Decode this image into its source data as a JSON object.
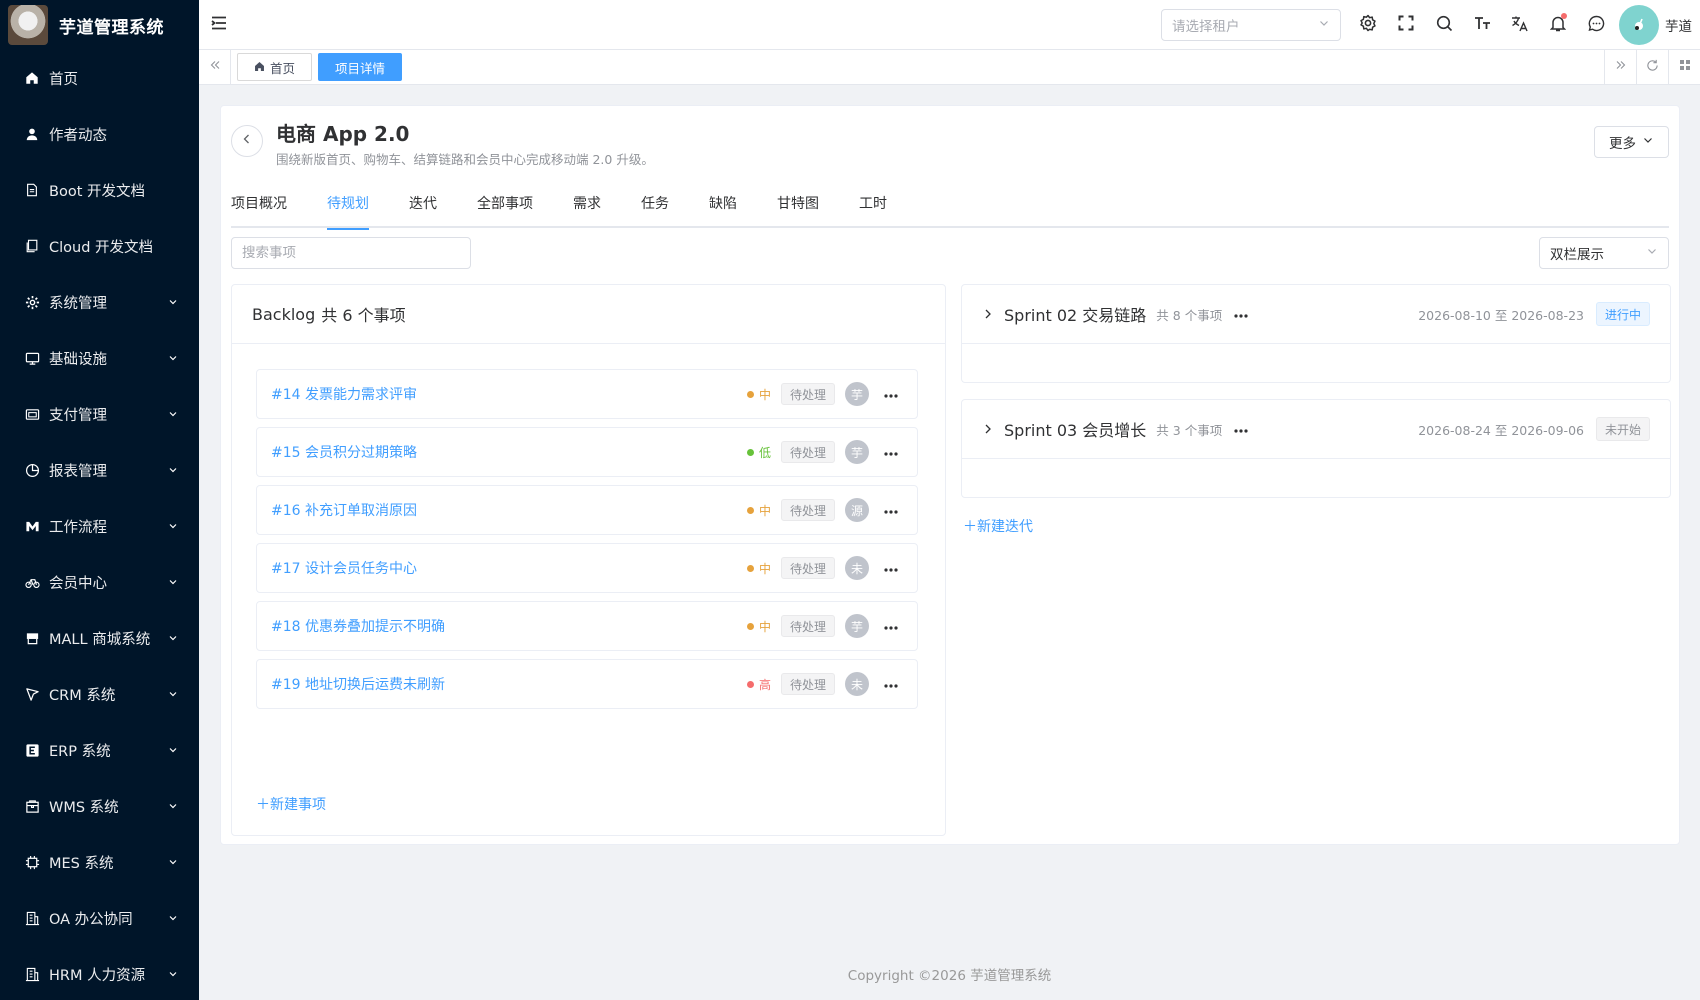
{
  "app": {
    "title": "芋道管理系统"
  },
  "sidebar": {
    "items": [
      {
        "label": "首页",
        "icon": "home-icon",
        "arrow": false
      },
      {
        "label": "作者动态",
        "icon": "user-icon",
        "arrow": false
      },
      {
        "label": "Boot 开发文档",
        "icon": "document-icon",
        "arrow": false
      },
      {
        "label": "Cloud 开发文档",
        "icon": "document-copy-icon",
        "arrow": false
      },
      {
        "label": "系统管理",
        "icon": "gear-icon",
        "arrow": true
      },
      {
        "label": "基础设施",
        "icon": "monitor-icon",
        "arrow": true
      },
      {
        "label": "支付管理",
        "icon": "wallet-icon",
        "arrow": true
      },
      {
        "label": "报表管理",
        "icon": "pie-chart-icon",
        "arrow": true
      },
      {
        "label": "工作流程",
        "icon": "workflow-icon",
        "arrow": true
      },
      {
        "label": "会员中心",
        "icon": "bicycle-icon",
        "arrow": true
      },
      {
        "label": "MALL 商城系统",
        "icon": "shop-icon",
        "arrow": true
      },
      {
        "label": "CRM 系统",
        "icon": "crm-icon",
        "arrow": true
      },
      {
        "label": "ERP 系统",
        "icon": "erp-icon",
        "arrow": true
      },
      {
        "label": "WMS 系统",
        "icon": "box-icon",
        "arrow": true
      },
      {
        "label": "MES 系统",
        "icon": "cpu-icon",
        "arrow": true
      },
      {
        "label": "OA 办公协同",
        "icon": "office-icon",
        "arrow": true
      },
      {
        "label": "HRM 人力资源",
        "icon": "office-icon",
        "arrow": true
      }
    ]
  },
  "header": {
    "tenant_placeholder": "请选择租户",
    "user_name": "芋道"
  },
  "tagsbar": {
    "tabs": [
      {
        "label": "首页",
        "active": false
      },
      {
        "label": "项目详情",
        "active": true
      }
    ]
  },
  "project": {
    "title": "电商 App 2.0",
    "description": "围绕新版首页、购物车、结算链路和会员中心完成移动端 2.0 升级。",
    "more_label": "更多"
  },
  "tabs": [
    {
      "label": "项目概况",
      "active": false
    },
    {
      "label": "待规划",
      "active": true
    },
    {
      "label": "迭代",
      "active": false
    },
    {
      "label": "全部事项",
      "active": false
    },
    {
      "label": "需求",
      "active": false
    },
    {
      "label": "任务",
      "active": false
    },
    {
      "label": "缺陷",
      "active": false
    },
    {
      "label": "甘特图",
      "active": false
    },
    {
      "label": "工时",
      "active": false
    }
  ],
  "toolbar": {
    "search_placeholder": "搜索事项",
    "view_mode": "双栏展示"
  },
  "backlog": {
    "title": "Backlog",
    "count_text": "共 6 个事项",
    "new_issue_label": "＋新建事项",
    "issues": [
      {
        "title": "#14 发票能力需求评审",
        "priority": "中",
        "priority_color": "#e6a23c",
        "status": "待处理",
        "assignee": "芋"
      },
      {
        "title": "#15 会员积分过期策略",
        "priority": "低",
        "priority_color": "#67c23a",
        "status": "待处理",
        "assignee": "芋"
      },
      {
        "title": "#16 补充订单取消原因",
        "priority": "中",
        "priority_color": "#e6a23c",
        "status": "待处理",
        "assignee": "源"
      },
      {
        "title": "#17 设计会员任务中心",
        "priority": "中",
        "priority_color": "#e6a23c",
        "status": "待处理",
        "assignee": "未"
      },
      {
        "title": "#18 优惠券叠加提示不明确",
        "priority": "中",
        "priority_color": "#e6a23c",
        "status": "待处理",
        "assignee": "芋"
      },
      {
        "title": "#19 地址切换后运费未刷新",
        "priority": "高",
        "priority_color": "#f56c6c",
        "status": "待处理",
        "assignee": "未"
      }
    ]
  },
  "sprints": [
    {
      "title": "Sprint 02 交易链路",
      "count": "共 8 个事项",
      "dates": "2026-08-10 至 2026-08-23",
      "status": "进行中",
      "status_color": "#409eff",
      "status_bg": "#ecf5ff",
      "status_border": "#d9ecff"
    },
    {
      "title": "Sprint 03 会员增长",
      "count": "共 3 个事项",
      "dates": "2026-08-24 至 2026-09-06",
      "status": "未开始",
      "status_color": "#909399",
      "status_bg": "#f4f4f5",
      "status_border": "#e9e9eb"
    }
  ],
  "new_sprint_label": "＋新建迭代",
  "footer": {
    "copyright": "Copyright ©2026 芋道管理系统"
  }
}
